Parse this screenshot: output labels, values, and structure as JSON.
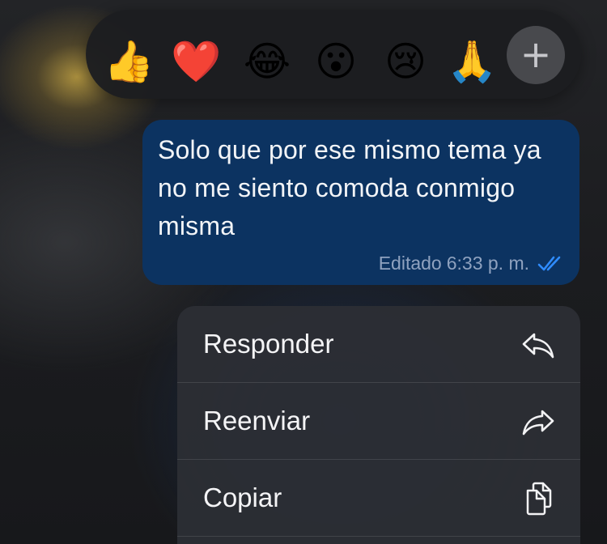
{
  "reactions": {
    "items": [
      {
        "emoji": "👍",
        "name": "thumbs-up"
      },
      {
        "emoji": "❤️",
        "name": "red-heart"
      },
      {
        "emoji": "😂",
        "name": "tears-of-joy"
      },
      {
        "emoji": "😮",
        "name": "open-mouth"
      },
      {
        "emoji": "😢",
        "name": "crying-face"
      },
      {
        "emoji": "🙏",
        "name": "folded-hands"
      }
    ],
    "more": "+"
  },
  "message": {
    "text": "Solo que por ese mismo tema ya no me siento comoda conmigo misma",
    "edited_label": "Editado",
    "time": "6:33 p. m.",
    "status_icon": "double-check-read-icon",
    "bubble_color": "#0c3361"
  },
  "menu": {
    "items": [
      {
        "label": "Responder",
        "icon": "reply-icon"
      },
      {
        "label": "Reenviar",
        "icon": "forward-icon"
      },
      {
        "label": "Copiar",
        "icon": "copy-icon"
      }
    ]
  }
}
